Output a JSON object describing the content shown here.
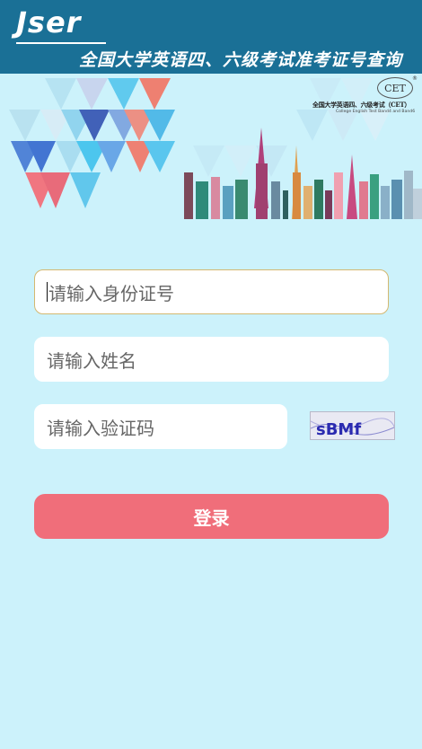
{
  "header": {
    "logo_text": "Jser",
    "title": "全国大学英语四、六级考试准考证号查询"
  },
  "banner": {
    "cet_badge": "CET",
    "cet_reg": "®",
    "cet_name_cn": "全国大学英语四、六级考试（CET）",
    "cet_name_en": "College English Test Band4 and Band6"
  },
  "form": {
    "id_placeholder": "请输入身份证号",
    "name_placeholder": "请输入姓名",
    "captcha_placeholder": "请输入验证码",
    "captcha_text": "sBMf",
    "login_label": "登录"
  },
  "colors": {
    "header_bg": "#1a7096",
    "page_bg": "#ccf2fb",
    "button_bg": "#f06e7a"
  }
}
